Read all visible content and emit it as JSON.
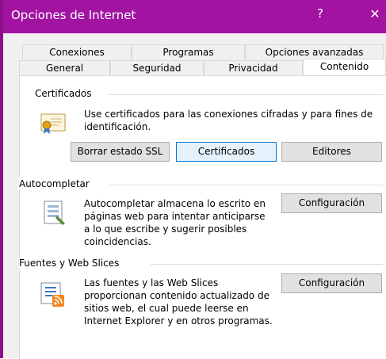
{
  "window": {
    "title": "Opciones de Internet",
    "help_glyph": "?",
    "close_glyph": "✕"
  },
  "tabs": {
    "row_top": [
      "Conexiones",
      "Programas",
      "Opciones avanzadas"
    ],
    "row_bottom": [
      "General",
      "Seguridad",
      "Privacidad",
      "Contenido"
    ],
    "active": "Contenido"
  },
  "certificates": {
    "heading": "Certificados",
    "description": "Use certificados para las conexiones cifradas y para fines de identificación.",
    "icon": "certificate-icon",
    "buttons": {
      "clear_ssl": "Borrar estado SSL",
      "certificates": "Certificados",
      "publishers": "Editores"
    }
  },
  "autocomplete": {
    "heading": "Autocompletar",
    "description": "Autocompletar almacena lo escrito en páginas web para intentar anticiparse a lo que escribe y sugerir posibles coincidencias.",
    "icon": "autocomplete-form-icon",
    "settings_button": "Configuración"
  },
  "feeds": {
    "heading": "Fuentes y Web Slices",
    "description": "Las fuentes y las Web Slices proporcionan contenido actualizado de sitios web, el cual puede leerse en Internet Explorer y en otros programas.",
    "icon": "rss-feed-icon",
    "settings_button": "Configuración"
  },
  "colors": {
    "titlebar": "#a213a2",
    "focus_border": "#0078d7",
    "button_face": "#e1e1e1"
  }
}
